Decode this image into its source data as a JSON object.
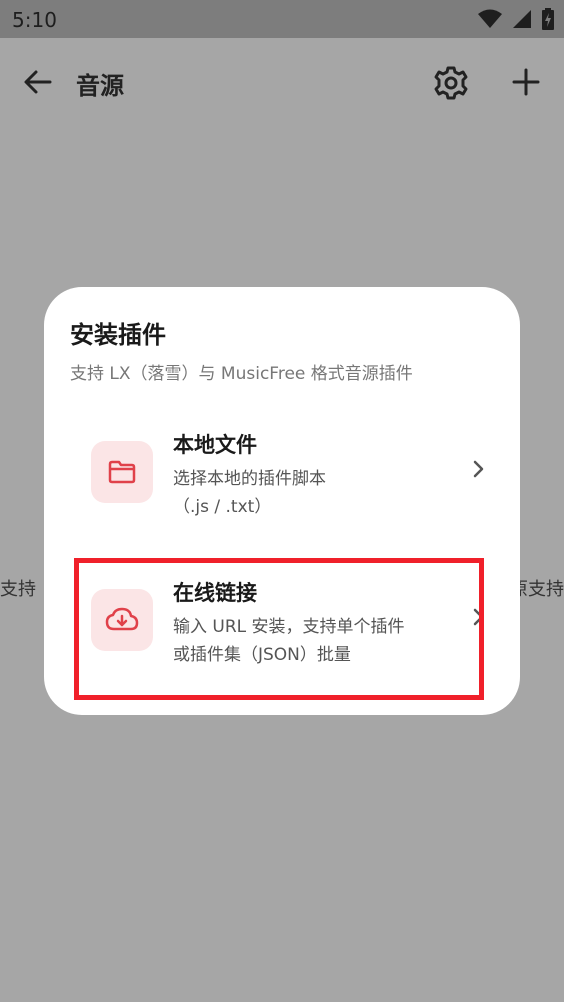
{
  "status": {
    "time": "5:10"
  },
  "appbar": {
    "title": "音源"
  },
  "background": {
    "left_text": "支持",
    "right_text": "原支持"
  },
  "dialog": {
    "title": "安装插件",
    "subtitle": "支持 LX（落雪）与 MusicFree 格式音源插件",
    "options": [
      {
        "title": "本地文件",
        "desc_line1": "选择本地的插件脚本",
        "desc_line2": "（.js / .txt）",
        "icon": "folder-icon"
      },
      {
        "title": "在线链接",
        "desc_line1": "输入 URL 安装，支持单个插件",
        "desc_line2": "或插件集（JSON）批量",
        "icon": "cloud-download-icon"
      }
    ]
  },
  "colors": {
    "accent": "#e0414a",
    "icon_bg": "#fbe5e6",
    "highlight": "#f0202a"
  }
}
